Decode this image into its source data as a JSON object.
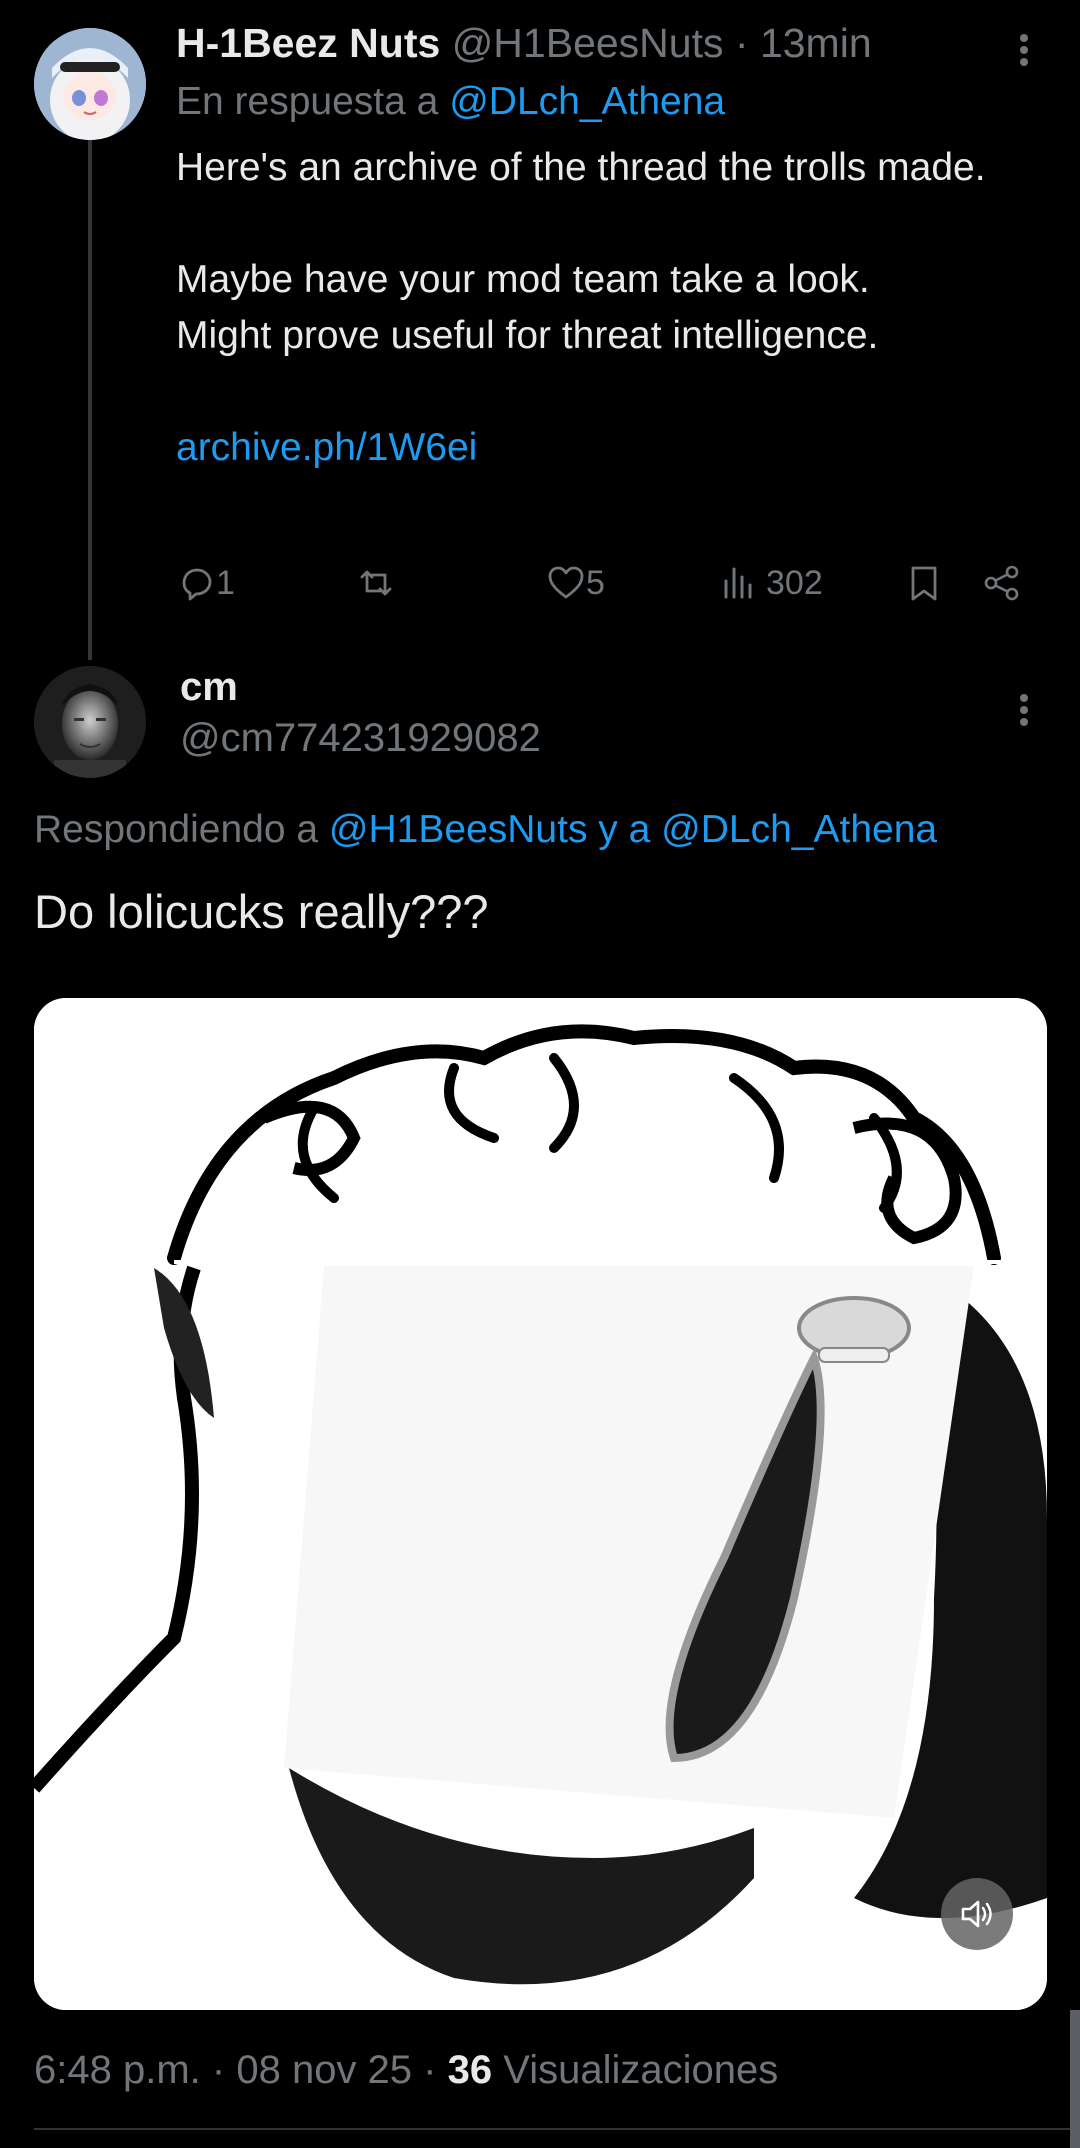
{
  "tweet1": {
    "display_name": "H-1Beez Nuts",
    "handle": "@H1BeesNuts",
    "time": "13min",
    "separator": "·",
    "reply_prefix": "En respuesta a",
    "reply_to": "@DLch_Athena",
    "body_line1": "Here's an archive of the thread the trolls made.",
    "body_line2": "Maybe have your mod team take a look.",
    "body_line3": "Might prove useful for threat intelligence.",
    "link": "archive.ph/1W6ei",
    "replies": "1",
    "likes": "5",
    "views": "302",
    "icons": [
      "reply-icon",
      "retweet-icon",
      "like-icon",
      "views-icon",
      "bookmark-icon",
      "share-icon",
      "more-icon"
    ]
  },
  "tweet2": {
    "display_name": "cm",
    "handle": "@cm774231929082",
    "reply_prefix": "Respondiendo a",
    "reply_to_1": "@H1BeesNuts",
    "reply_joiner": "y a",
    "reply_to_2": "@DLch_Athena",
    "text": "Do lolicucks really???",
    "media_controls": [
      "mute-icon"
    ],
    "time": "6:48 p.m.",
    "date": "08 nov 25",
    "views_count": "36",
    "views_label": "Visualizaciones",
    "separator": "·"
  },
  "colors": {
    "background": "#000000",
    "text": "#e7e9ea",
    "muted": "#71767b",
    "accent": "#1d9bf0"
  }
}
